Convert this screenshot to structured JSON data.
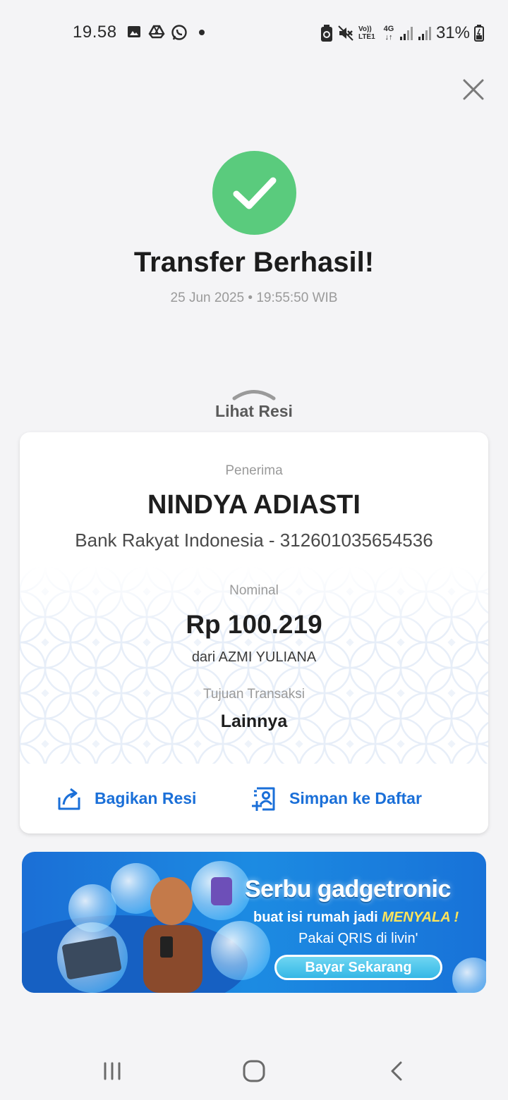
{
  "status_bar": {
    "time": "19.58",
    "battery": "31%",
    "icons": [
      "image-icon",
      "drive-icon",
      "whatsapp-icon",
      "dot-icon",
      "battery-saver-icon",
      "mute-icon",
      "volte-icon",
      "4g-icon",
      "signal-icon",
      "signal-icon",
      "battery-icon"
    ],
    "volte_label": "Vo)) LTE1",
    "network_label": "4G"
  },
  "success": {
    "title": "Transfer Berhasil!",
    "datetime": "25 Jun 2025 • 19:55:50 WIB",
    "color": "#5acb7d"
  },
  "receipt_toggle": {
    "label": "Lihat Resi"
  },
  "receipt": {
    "recipient_label": "Penerima",
    "recipient_name": "NINDYA ADIASTI",
    "recipient_bank": "Bank Rakyat Indonesia - 312601035654536",
    "amount_label": "Nominal",
    "amount": "Rp 100.219",
    "from": "dari AZMI YULIANA",
    "purpose_label": "Tujuan Transaksi",
    "purpose": "Lainnya"
  },
  "actions": {
    "share_label": "Bagikan Resi",
    "save_label": "Simpan ke Daftar",
    "accent": "#1a6fd8"
  },
  "banner": {
    "headline": "Serbu gadgetronic",
    "line2_prefix": "buat isi rumah jadi ",
    "line2_highlight": "MENYALA !",
    "line3": "Pakai QRIS di livin'",
    "button": "Bayar Sekarang"
  }
}
